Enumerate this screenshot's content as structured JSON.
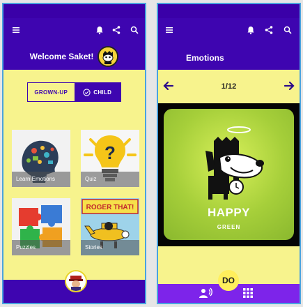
{
  "left_screen": {
    "welcome_text": "Welcome Saket!",
    "toggle": {
      "grown_up_label": "GROWN-UP",
      "child_label": "CHILD",
      "selected": "CHILD"
    },
    "tiles": [
      {
        "label": "Learn Emotions"
      },
      {
        "label": "Quiz"
      },
      {
        "label": "Puzzles"
      },
      {
        "label": "Stories",
        "art_text": "ROGER THAT!"
      }
    ]
  },
  "right_screen": {
    "title": "Emotions",
    "counter": "1/12",
    "card": {
      "emotion": "HAPPY",
      "color_name": "GREEN"
    },
    "do_button": "DO"
  },
  "icons": [
    "menu-icon",
    "bell-icon",
    "share-icon",
    "search-icon",
    "arrow-back-icon",
    "arrow-forward-icon",
    "check-circle-icon",
    "voice-icon",
    "grid-icon"
  ],
  "colors": {
    "primary": "#3e05b0",
    "background": "#f7f38d",
    "bottom_right": "#7d24ea",
    "fab": "#ffef5c"
  }
}
